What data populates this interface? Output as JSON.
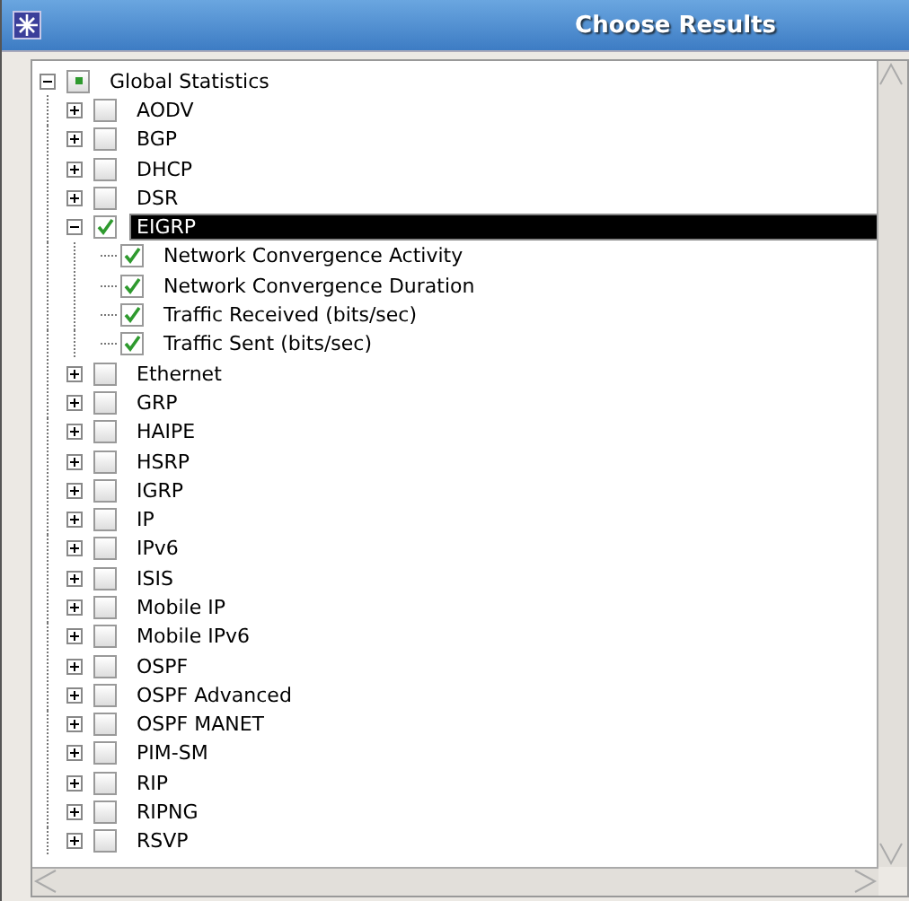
{
  "window": {
    "title": "Choose Results"
  },
  "tree": [
    {
      "label": "Global Statistics",
      "expanded": true,
      "partial": true,
      "selected": false,
      "children": [
        {
          "label": "AODV",
          "expanded": false,
          "checked": false,
          "selected": false
        },
        {
          "label": "BGP",
          "expanded": false,
          "checked": false,
          "selected": false
        },
        {
          "label": "DHCP",
          "expanded": false,
          "checked": false,
          "selected": false
        },
        {
          "label": "DSR",
          "expanded": false,
          "checked": false,
          "selected": false
        },
        {
          "label": "EIGRP",
          "expanded": true,
          "checked": true,
          "selected": true,
          "children": [
            {
              "label": "Network Convergence Activity",
              "checked": true,
              "selected": false
            },
            {
              "label": "Network Convergence Duration",
              "checked": true,
              "selected": false
            },
            {
              "label": "Traffic Received (bits/sec)",
              "checked": true,
              "selected": false
            },
            {
              "label": "Traffic Sent (bits/sec)",
              "checked": true,
              "selected": false
            }
          ]
        },
        {
          "label": "Ethernet",
          "expanded": false,
          "checked": false,
          "selected": false
        },
        {
          "label": "GRP",
          "expanded": false,
          "checked": false,
          "selected": false
        },
        {
          "label": "HAIPE",
          "expanded": false,
          "checked": false,
          "selected": false
        },
        {
          "label": "HSRP",
          "expanded": false,
          "checked": false,
          "selected": false
        },
        {
          "label": "IGRP",
          "expanded": false,
          "checked": false,
          "selected": false
        },
        {
          "label": "IP",
          "expanded": false,
          "checked": false,
          "selected": false
        },
        {
          "label": "IPv6",
          "expanded": false,
          "checked": false,
          "selected": false
        },
        {
          "label": "ISIS",
          "expanded": false,
          "checked": false,
          "selected": false
        },
        {
          "label": "Mobile IP",
          "expanded": false,
          "checked": false,
          "selected": false
        },
        {
          "label": "Mobile IPv6",
          "expanded": false,
          "checked": false,
          "selected": false
        },
        {
          "label": "OSPF",
          "expanded": false,
          "checked": false,
          "selected": false
        },
        {
          "label": "OSPF Advanced",
          "expanded": false,
          "checked": false,
          "selected": false
        },
        {
          "label": "OSPF MANET",
          "expanded": false,
          "checked": false,
          "selected": false
        },
        {
          "label": "PIM-SM",
          "expanded": false,
          "checked": false,
          "selected": false
        },
        {
          "label": "RIP",
          "expanded": false,
          "checked": false,
          "selected": false
        },
        {
          "label": "RIPNG",
          "expanded": false,
          "checked": false,
          "selected": false
        },
        {
          "label": "RSVP",
          "expanded": false,
          "checked": false,
          "selected": false
        }
      ]
    }
  ]
}
